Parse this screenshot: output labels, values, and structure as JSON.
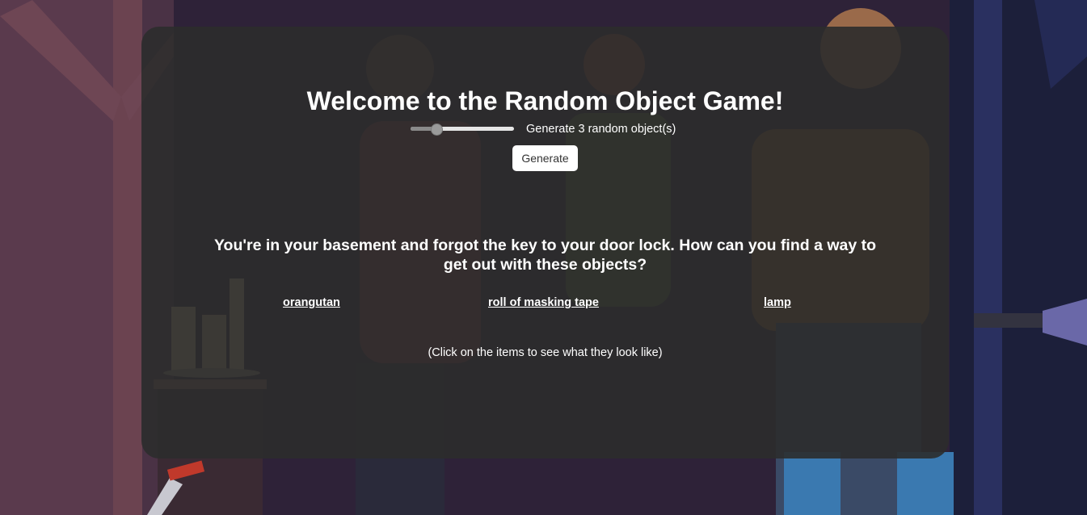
{
  "game": {
    "title": "Welcome to the Random Object Game!",
    "slider": {
      "value": 3,
      "min": 1,
      "max": 10,
      "label": "Generate 3 random object(s)"
    },
    "generate_label": "Generate",
    "prompt": "You're in your basement and forgot the key to your door lock. How can you find a way to get out with these objects?",
    "objects": [
      "orangutan",
      "roll of masking tape",
      "lamp"
    ],
    "hint": "(Click on the items to see what they look like)"
  },
  "colors": {
    "panel": "#2c2c2c",
    "text": "#ffffff",
    "button_bg": "#ffffff"
  }
}
